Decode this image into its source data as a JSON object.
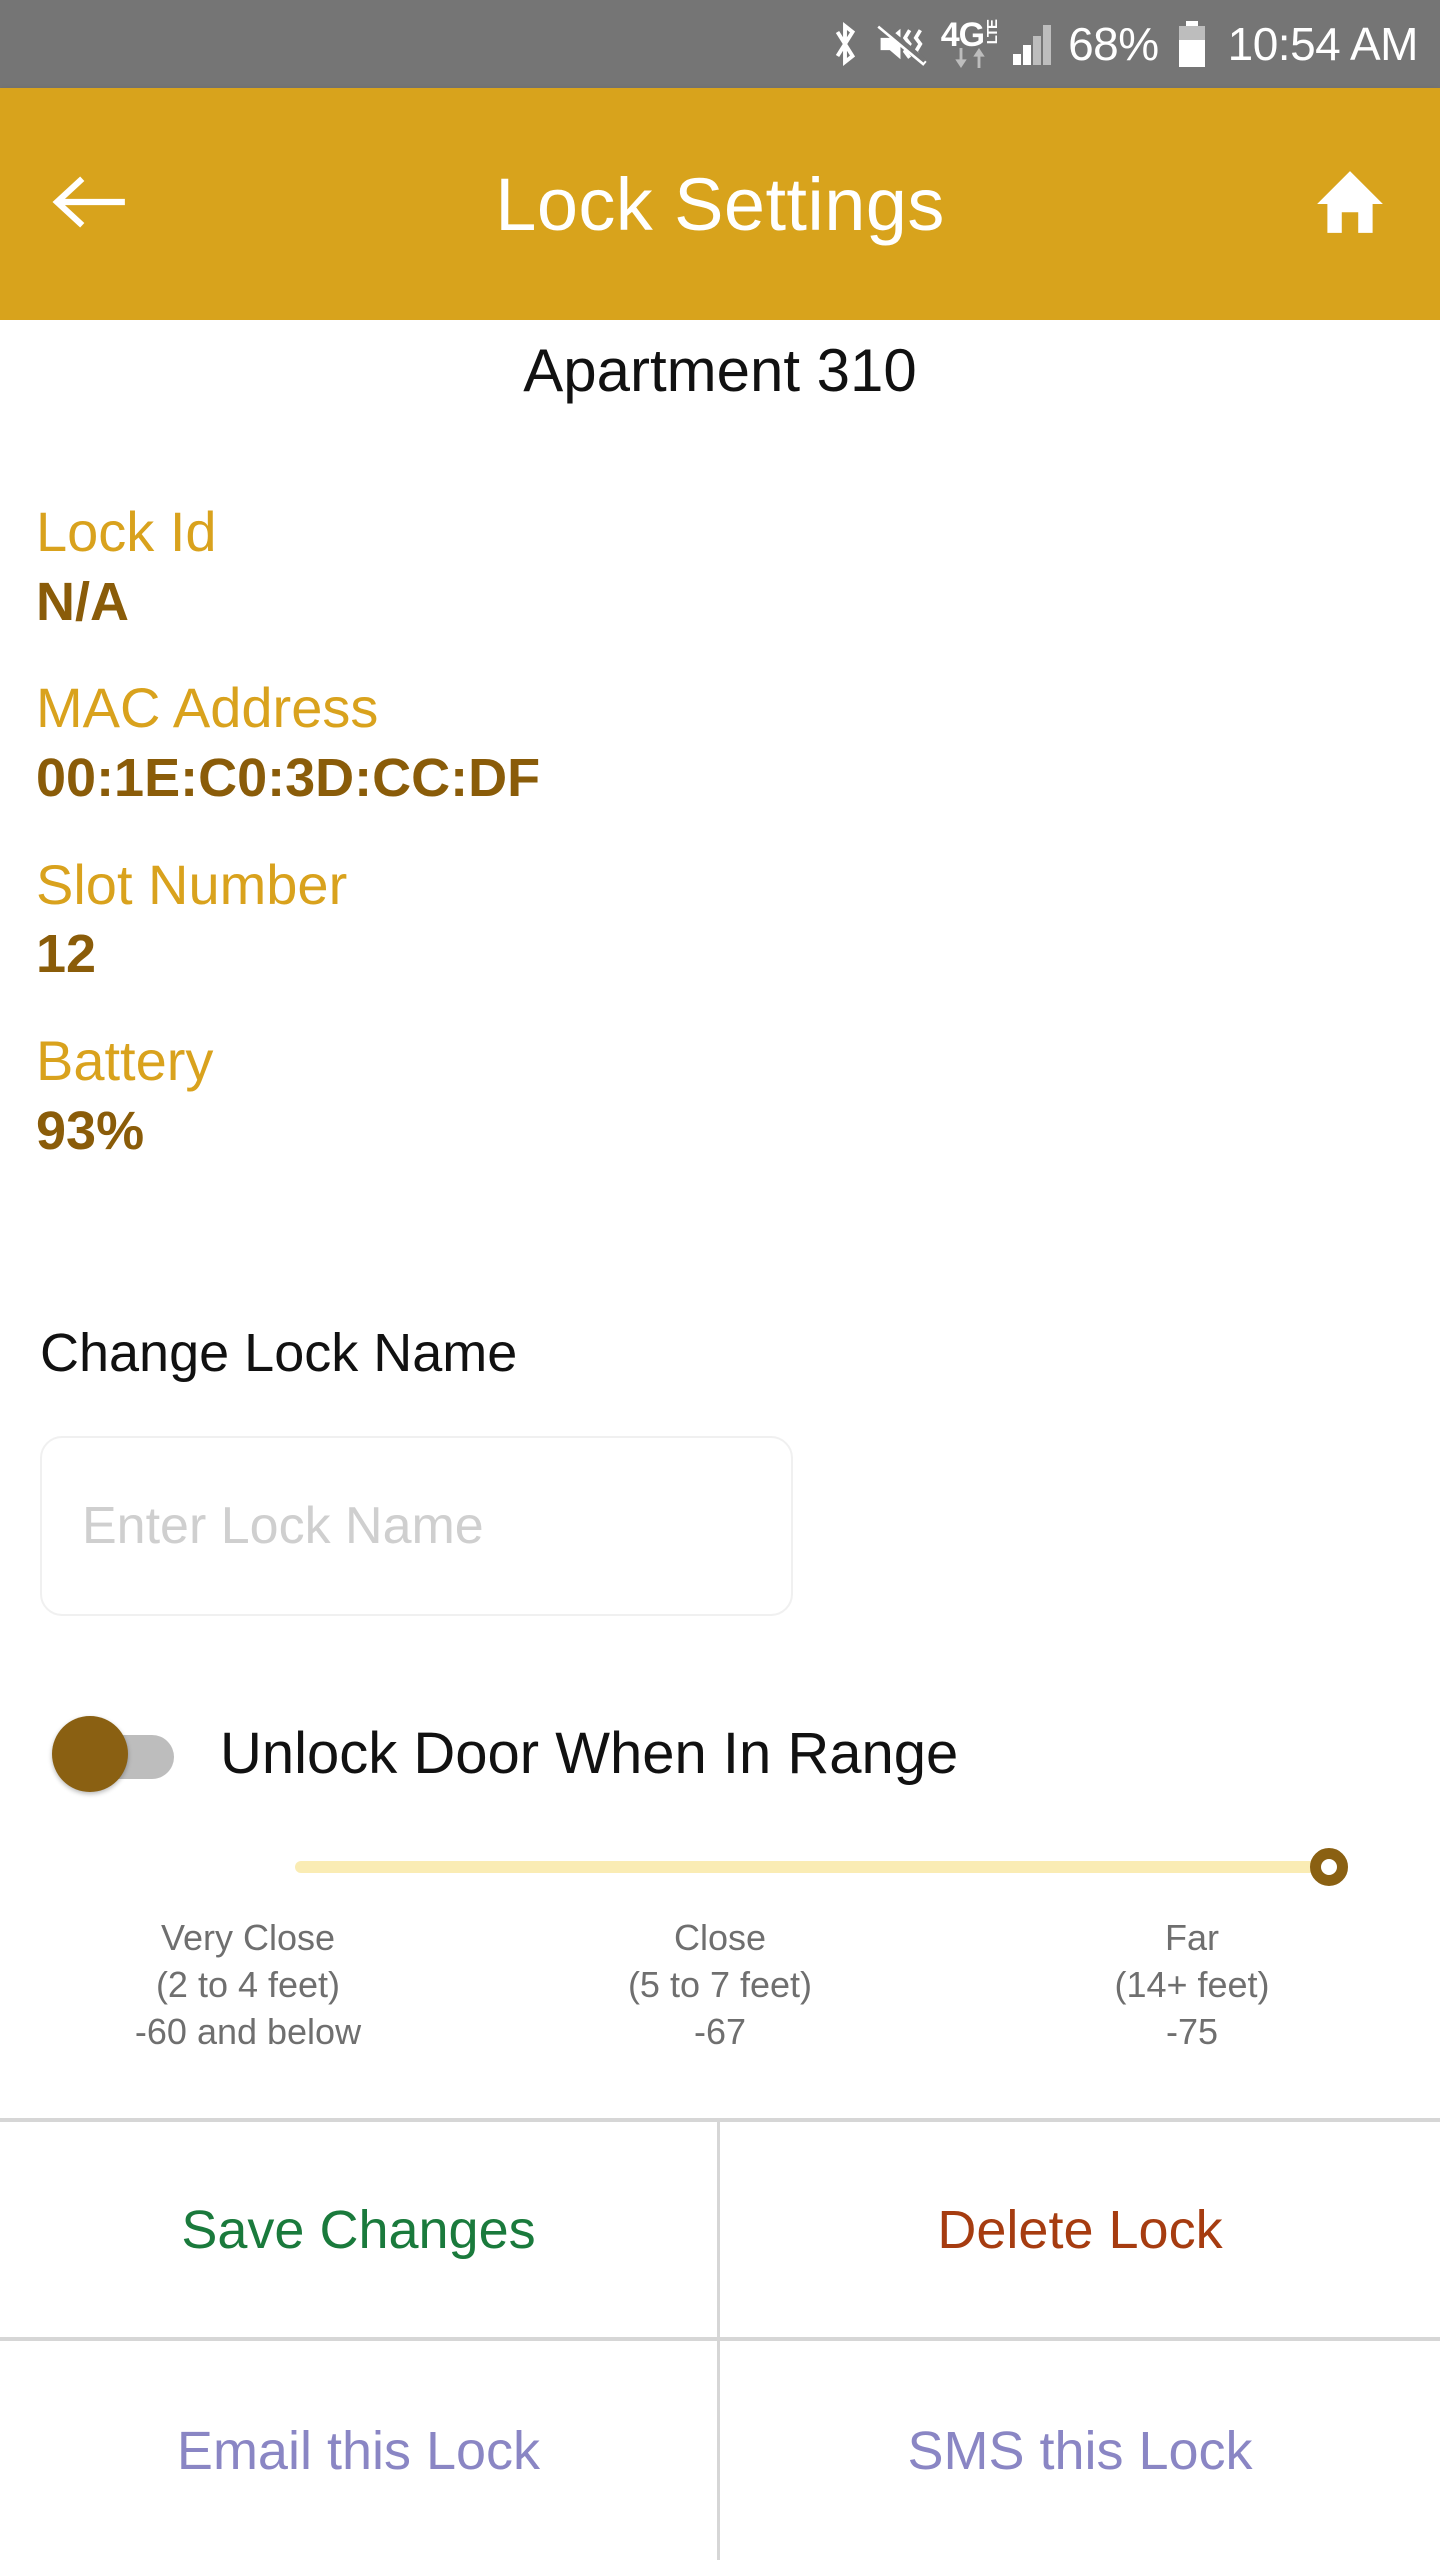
{
  "status_bar": {
    "bluetooth_icon": "bluetooth-icon",
    "sound_off_icon": "vibrate-mute-icon",
    "network_type": "4G",
    "network_sub": "LTE",
    "signal_icon": "signal-bars-icon",
    "battery_percent": "68%",
    "battery_icon": "battery-icon",
    "time": "10:54 AM",
    "background": "#757575"
  },
  "app_bar": {
    "back_icon": "arrow-left-icon",
    "title": "Lock Settings",
    "home_icon": "home-icon",
    "background": "#d8a31c"
  },
  "lock": {
    "name": "Apartment 310",
    "fields": [
      {
        "label": "Lock Id",
        "value": "N/A"
      },
      {
        "label": "MAC Address",
        "value": "00:1E:C0:3D:CC:DF"
      },
      {
        "label": "Slot Number",
        "value": "12"
      },
      {
        "label": "Battery",
        "value": "93%"
      }
    ],
    "label_color": "#d9a21d",
    "value_color": "#8a5c09"
  },
  "change_name": {
    "heading": "Change Lock Name",
    "input_value": "",
    "input_placeholder": "Enter Lock Name"
  },
  "range_toggle": {
    "label": "Unlock Door When In Range",
    "enabled": false,
    "thumb_color": "#8a6012",
    "track_color": "#bdbdbd"
  },
  "range_slider": {
    "track_color": "#faecb4",
    "thumb_color": "#8a6012",
    "position_percent": 100,
    "legend": [
      {
        "title": "Very Close",
        "distance": "(2 to 4 feet)",
        "rssi": "-60 and below"
      },
      {
        "title": "Close",
        "distance": "(5 to 7 feet)",
        "rssi": "-67"
      },
      {
        "title": "Far",
        "distance": "(14+ feet)",
        "rssi": "-75"
      }
    ]
  },
  "actions": {
    "save": "Save Changes",
    "delete": "Delete Lock",
    "email": "Email this Lock",
    "sms": "SMS this Lock",
    "save_color": "#1a7a3c",
    "delete_color": "#a63c10",
    "link_color": "#8a86c4"
  }
}
